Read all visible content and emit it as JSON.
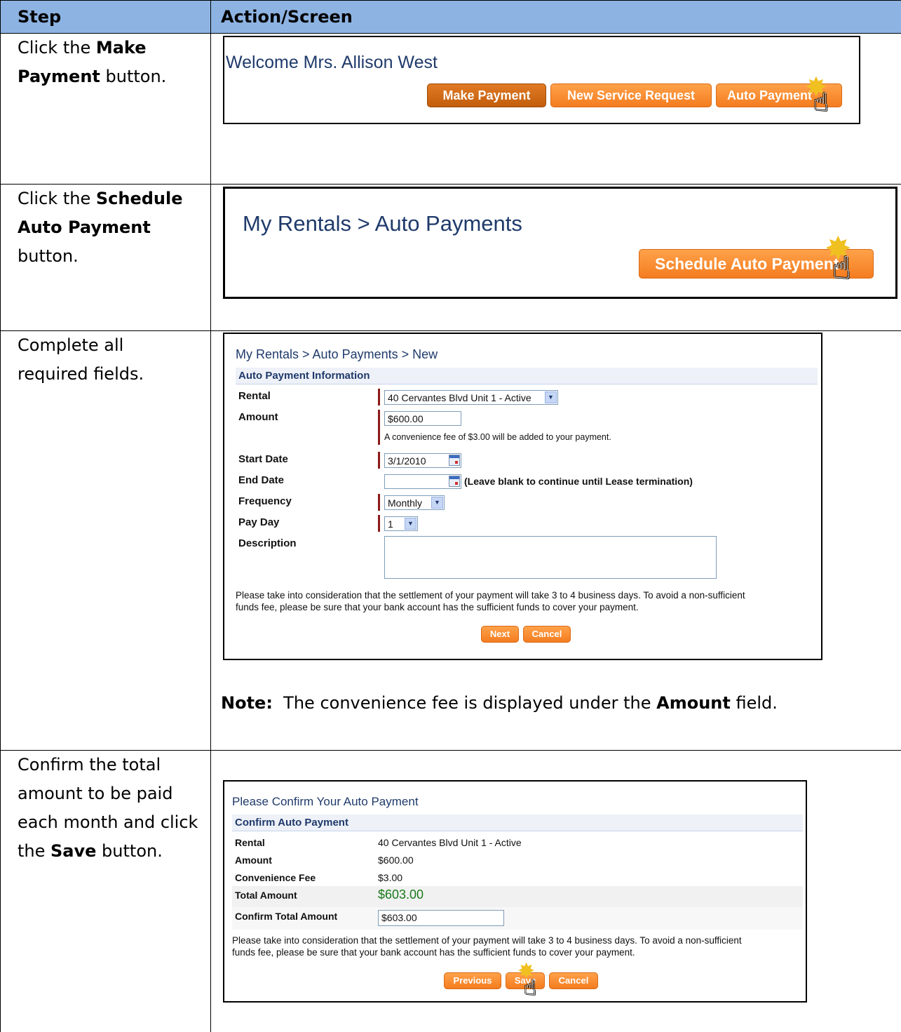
{
  "header": {
    "col1": "Step",
    "col2": "Action/Screen"
  },
  "steps": {
    "s1": {
      "a": "Click the ",
      "b": "Make",
      "c": "Payment",
      "d": " button."
    },
    "s2": {
      "a": "Click the ",
      "b": "Schedule",
      "c": "Auto Payment",
      "d": "button."
    },
    "s3": {
      "a": "Complete all",
      "b": "required fields."
    },
    "s4": {
      "a": "Confirm the total",
      "b": "amount to be paid",
      "c": "each month and click",
      "d": "the ",
      "e": "Save",
      "f": " button."
    }
  },
  "shot1": {
    "welcome": "Welcome Mrs. Allison West",
    "make_payment": "Make Payment",
    "new_service": "New Service Request",
    "auto_payment": "Auto Payment"
  },
  "shot2": {
    "title": "My Rentals > Auto Payments",
    "schedule": "Schedule Auto Payment"
  },
  "shot3": {
    "title": "My Rentals > Auto Payments > New",
    "section": "Auto Payment Information",
    "labels": {
      "rental": "Rental",
      "amount": "Amount",
      "start": "Start Date",
      "end": "End Date",
      "frequency": "Frequency",
      "payday": "Pay Day",
      "description": "Description"
    },
    "rental_value": "40 Cervantes Blvd Unit 1 - Active",
    "amount_value": "$600.00",
    "fee_note": "A convenience fee of $3.00 will be added to your payment.",
    "start_value": "3/1/2010",
    "end_value": "",
    "end_hint": "(Leave blank to continue until Lease termination)",
    "frequency_value": "Monthly",
    "payday_value": "1",
    "description_value": "",
    "para1": "Please take into consideration that the settlement of your payment will take 3 to 4 business days. To avoid a non-sufficient",
    "para2": "funds fee, please be sure that your bank account has the sufficient funds to cover your payment.",
    "next": "Next",
    "cancel": "Cancel"
  },
  "note": {
    "label": "Note:",
    "text1": "  The convenience fee is displayed under the ",
    "field": "Amount",
    "text2": " field."
  },
  "shot4": {
    "title": "Please Confirm Your Auto Payment",
    "section": "Confirm Auto Payment",
    "labels": {
      "rental": "Rental",
      "amount": "Amount",
      "fee": "Convenience Fee",
      "total": "Total Amount",
      "confirm": "Confirm Total Amount"
    },
    "rental_value": "40 Cervantes Blvd Unit 1 - Active",
    "amount_value": "$600.00",
    "fee_value": "$3.00",
    "total_value": "$603.00",
    "confirm_value": "$603.00",
    "para1": "Please take into consideration that the settlement of your payment will take 3 to 4 business days. To avoid a non-sufficient",
    "para2": "funds fee, please be sure that your bank account has the sufficient funds to cover your payment.",
    "previous": "Previous",
    "save": "Save",
    "cancel": "Cancel"
  },
  "colors": {
    "header_bg": "#8db3e2",
    "button_orange": "#f47c20",
    "navy_text": "#1f3a6b",
    "total_green": "#1a7a1a",
    "required_marker": "#8b1a1a"
  },
  "icons": {
    "cursor": "hand-pointer-icon",
    "click": "click-burst-icon",
    "calendar": "calendar-icon",
    "dropdown": "chevron-down-icon"
  }
}
